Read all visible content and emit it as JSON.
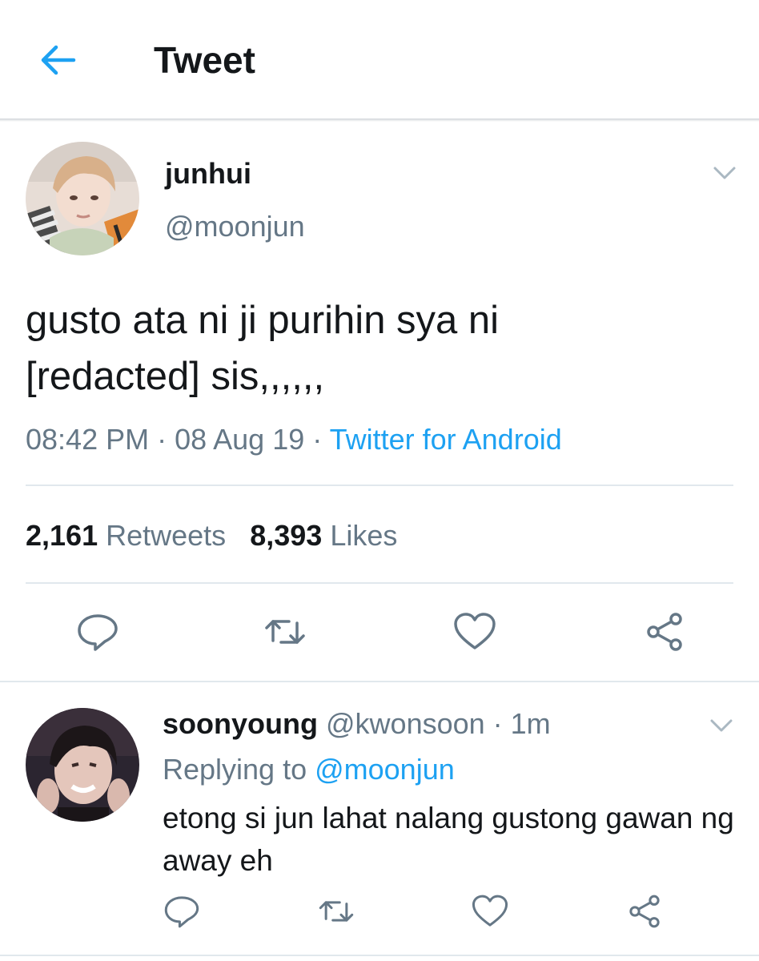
{
  "header": {
    "title": "Tweet",
    "back_icon": "arrow-left-icon"
  },
  "tweet": {
    "author_name": "junhui",
    "author_handle": "@moonjun",
    "text_line1": "gusto ata ni ji purihin sya ni",
    "text_line2": "[redacted] sis,,,,,,",
    "time": "08:42 PM",
    "sep1": " · ",
    "date": "08 Aug 19",
    "sep2": " · ",
    "source": "Twitter for Android",
    "retweets_count": "2,161",
    "retweets_label": "Retweets",
    "likes_count": "8,393",
    "likes_label": "Likes"
  },
  "reply": {
    "name": "soonyoung",
    "handle": "@kwonsoon",
    "sep": " · ",
    "age": "1m",
    "replying_label": "Replying to ",
    "replying_handle": "@moonjun",
    "text": "etong si jun lahat nalang gustong gawan ng away eh"
  },
  "colors": {
    "accent": "#1da1f2",
    "secondary_text": "#657786",
    "primary_text": "#14171a",
    "divider": "#e1e8ed"
  },
  "icons": [
    "reply-icon",
    "retweet-icon",
    "like-icon",
    "share-icon",
    "chevron-down-icon"
  ]
}
